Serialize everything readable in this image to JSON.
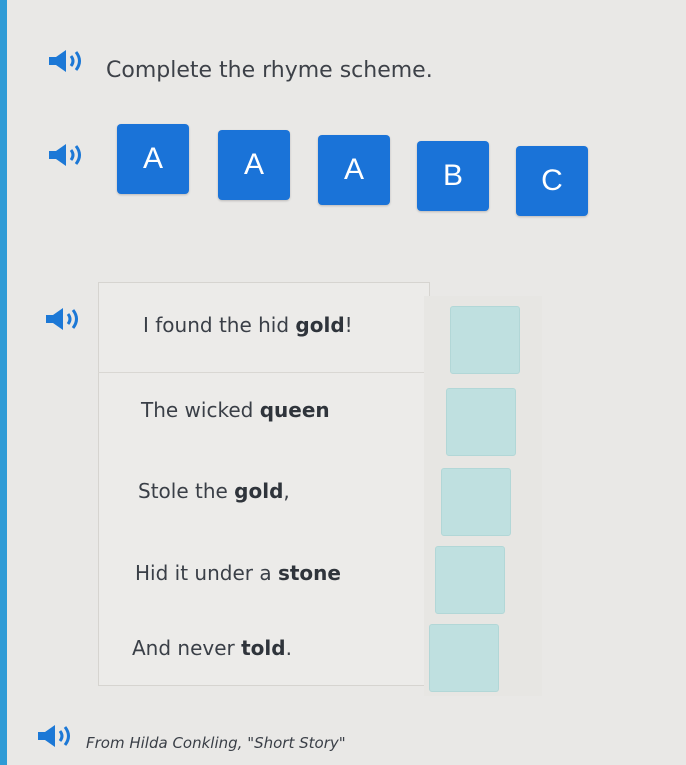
{
  "prompt": {
    "text": "Complete the rhyme scheme."
  },
  "tiles": [
    "A",
    "A",
    "A",
    "B",
    "C"
  ],
  "poem": [
    {
      "pre": "I found the hid ",
      "rhyme": "gold",
      "post": "!"
    },
    {
      "pre": "The wicked ",
      "rhyme": "queen",
      "post": ""
    },
    {
      "pre": "Stole the ",
      "rhyme": "gold",
      "post": ","
    },
    {
      "pre": "Hid it under a ",
      "rhyme": "stone",
      "post": ""
    },
    {
      "pre": "And never ",
      "rhyme": "told",
      "post": "."
    }
  ],
  "source": {
    "text": "From Hilda Conkling, \"Short Story\""
  },
  "colors": {
    "tile": "#1a73d8",
    "slot": "#bfe0e0",
    "speaker": "#1c78d6",
    "accent_bar": "#2f9bd6"
  },
  "icons": {
    "speaker": "speaker-icon"
  }
}
